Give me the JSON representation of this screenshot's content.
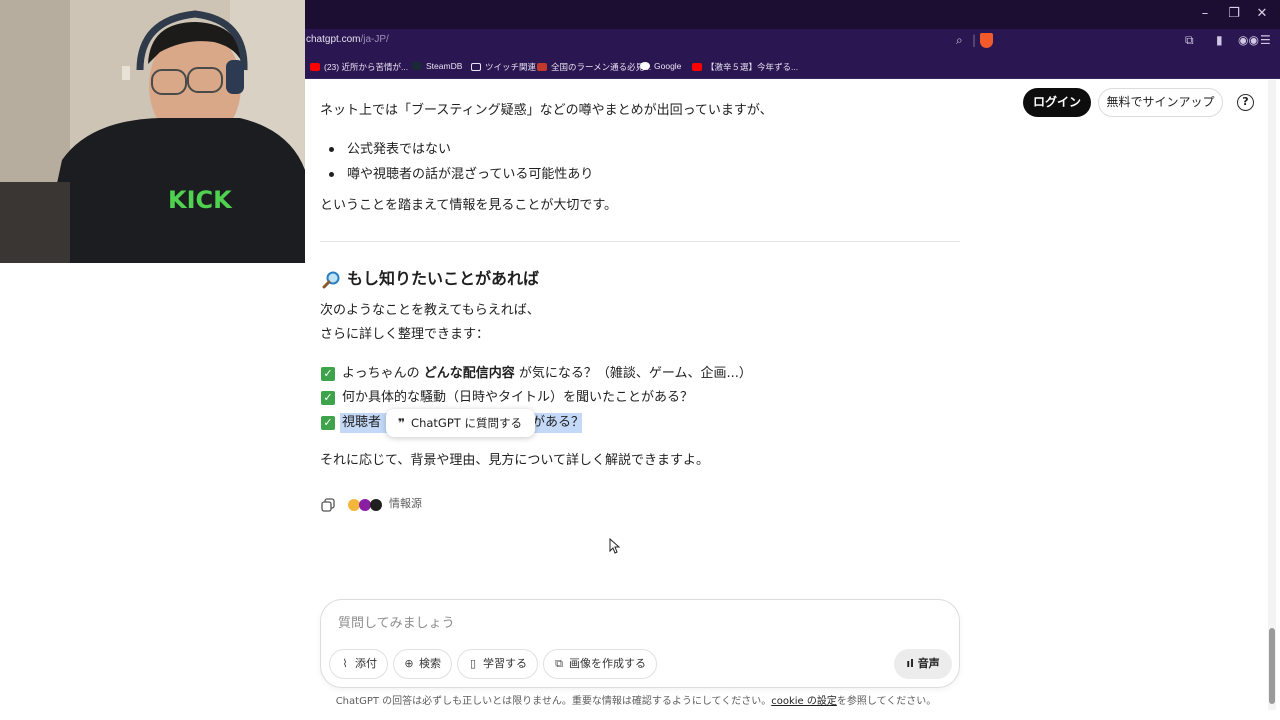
{
  "browser": {
    "url_host": "chatgpt.com",
    "url_path": "/ja-JP/",
    "bookmarks": [
      "(23) 近所から苦情が...",
      "SteamDB",
      "ツイッチ関連",
      "全国のラーメン通る必見...",
      "Google",
      "【激辛５選】今年ずる..."
    ]
  },
  "header": {
    "login_label": "ログイン",
    "signup_label": "無料でサインアップ",
    "help_label": "?"
  },
  "message": {
    "intro": "ネット上では「ブースティング疑惑」などの噂やまとめが出回っていますが、",
    "bullets": [
      "公式発表ではない",
      "噂や視聴者の話が混ざっている可能性あり"
    ],
    "conclusion": "ということを踏まえて情報を見ることが大切です。",
    "section_emoji": "🔎",
    "section_title": "もし知りたいことがあれば",
    "lead_1": "次のようなことを教えてもらえれば、",
    "lead_2": "さらに詳しく整理できます：",
    "check_1_pre": "よっちゃんの ",
    "check_1_bold": "どんな配信内容",
    "check_1_post": " が気になる？（雑談、ゲーム、企画...）",
    "check_2": "何か具体的な騒動（日時やタイトル）を聞いたことがある？",
    "check_3_visible_start": "視聴者",
    "check_3_visible_end": "がある？",
    "closing": "それに応じて、背景や理由、見方について詳しく解説できますよ。",
    "sources_label": "情報源"
  },
  "popup": {
    "quote_glyph": "❞",
    "label": "ChatGPT に質問する"
  },
  "composer": {
    "placeholder": "質問してみましょう",
    "buttons": [
      {
        "label": "添付",
        "icon": "paperclip-icon"
      },
      {
        "label": "検索",
        "icon": "globe-icon"
      },
      {
        "label": "学習する",
        "icon": "book-icon"
      },
      {
        "label": "画像を作成する",
        "icon": "image-icon"
      }
    ],
    "voice_label": "音声"
  },
  "footer": {
    "text_before": "ChatGPT の回答は必ずしも正しいとは限りません。重要な情報は確認するようにしてください。",
    "link": "cookie の設定",
    "text_after": "を参照してください。"
  },
  "webcam_shirt_text": "KICK"
}
